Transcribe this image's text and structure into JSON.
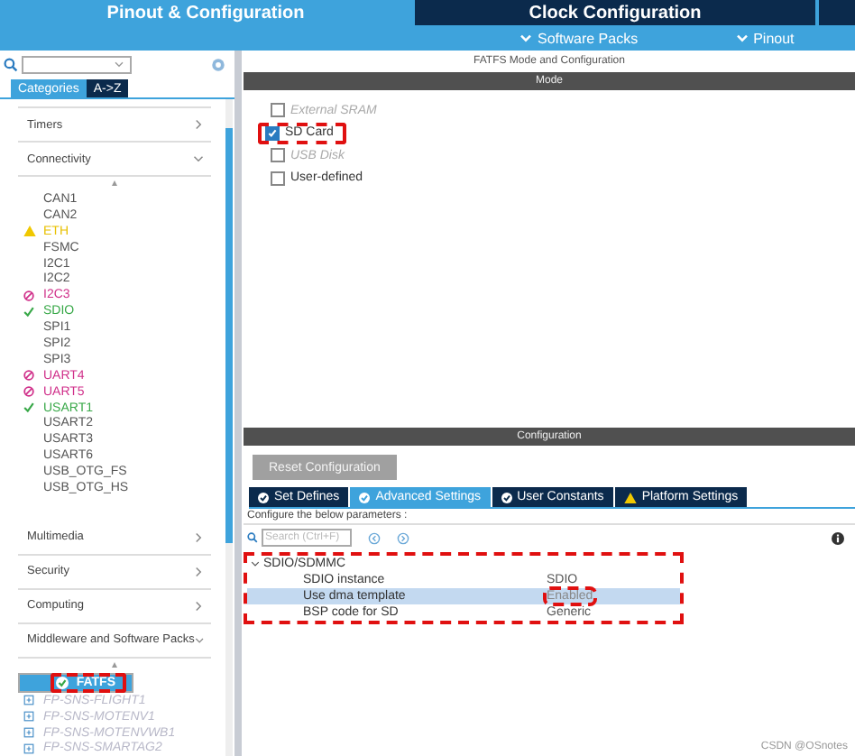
{
  "top_tabs": [
    {
      "label": "Pinout & Configuration",
      "selected": true
    },
    {
      "label": "Clock Configuration",
      "selected": false
    }
  ],
  "sub_menus": [
    {
      "label": "Software Packs"
    },
    {
      "label": "Pinout"
    }
  ],
  "sidebar": {
    "view_tabs": [
      {
        "label": "Categories",
        "selected": true
      },
      {
        "label": "A->Z",
        "selected": false
      }
    ],
    "categories": [
      {
        "label": "Timers",
        "expanded": false
      },
      {
        "label": "Connectivity",
        "expanded": true,
        "children": [
          {
            "label": "CAN1",
            "kind": "plain"
          },
          {
            "label": "CAN2",
            "kind": "plain"
          },
          {
            "label": "ETH",
            "kind": "warning"
          },
          {
            "label": "FSMC",
            "kind": "plain"
          },
          {
            "label": "I2C1",
            "kind": "plain"
          },
          {
            "label": "I2C2",
            "kind": "plain"
          },
          {
            "label": "I2C3",
            "kind": "error"
          },
          {
            "label": "SDIO",
            "kind": "ok"
          },
          {
            "label": "SPI1",
            "kind": "plain"
          },
          {
            "label": "SPI2",
            "kind": "plain"
          },
          {
            "label": "SPI3",
            "kind": "plain"
          },
          {
            "label": "UART4",
            "kind": "error"
          },
          {
            "label": "UART5",
            "kind": "error"
          },
          {
            "label": "USART1",
            "kind": "ok"
          },
          {
            "label": "USART2",
            "kind": "plain"
          },
          {
            "label": "USART3",
            "kind": "plain"
          },
          {
            "label": "USART6",
            "kind": "plain"
          },
          {
            "label": "USB_OTG_FS",
            "kind": "plain"
          },
          {
            "label": "USB_OTG_HS",
            "kind": "plain"
          }
        ]
      },
      {
        "label": "Multimedia",
        "expanded": false
      },
      {
        "label": "Security",
        "expanded": false
      },
      {
        "label": "Computing",
        "expanded": false
      },
      {
        "label": "Middleware and Software Packs",
        "expanded": true,
        "children": [
          {
            "label": "FATFS",
            "kind": "ok",
            "selected": true,
            "annotated": true
          },
          {
            "label": "FP-SNS-FLIGHT1",
            "kind": "pack",
            "selected": false,
            "annotated": false
          },
          {
            "label": "FP-SNS-MOTENV1",
            "kind": "pack",
            "selected": false,
            "annotated": false
          },
          {
            "label": "FP-SNS-MOTENVWB1",
            "kind": "pack",
            "selected": false,
            "annotated": false
          },
          {
            "label": "FP-SNS-SMARTAG2",
            "kind": "pack",
            "selected": false,
            "annotated": false
          }
        ]
      }
    ]
  },
  "panel": {
    "title": "FATFS Mode and Configuration",
    "mode_header": "Mode",
    "mode_options": [
      {
        "label": "External SRAM",
        "checked": false,
        "disabled": true,
        "annotated": false
      },
      {
        "label": "SD Card",
        "checked": true,
        "disabled": false,
        "annotated": true
      },
      {
        "label": "USB Disk",
        "checked": false,
        "disabled": true,
        "annotated": false
      },
      {
        "label": "User-defined",
        "checked": false,
        "disabled": false,
        "annotated": false
      }
    ],
    "config_header": "Configuration",
    "reset_button": "Reset Configuration",
    "tabs": [
      {
        "label": "Set Defines",
        "kind": "ok",
        "selected": false
      },
      {
        "label": "Advanced Settings",
        "kind": "ok",
        "selected": true
      },
      {
        "label": "User Constants",
        "kind": "ok",
        "selected": false
      },
      {
        "label": "Platform Settings",
        "kind": "warning",
        "selected": false
      }
    ],
    "hint": "Configure the below parameters :",
    "search_placeholder": "Search (Ctrl+F)",
    "groups": [
      {
        "label": "SDIO/SDMMC",
        "expanded": true,
        "annotated": true,
        "parameters": [
          {
            "name": "SDIO instance",
            "value": "SDIO",
            "selected": false,
            "annotated": false
          },
          {
            "name": "Use dma template",
            "value": "Enabled",
            "selected": true,
            "annotated": true
          },
          {
            "name": "BSP code for SD",
            "value": "Generic",
            "selected": false,
            "annotated": false
          }
        ]
      }
    ]
  },
  "watermark": "CSDN @OSnotes"
}
